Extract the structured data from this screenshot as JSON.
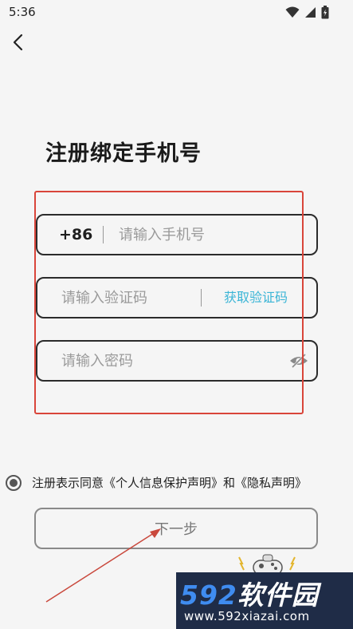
{
  "status_bar": {
    "time": "5:36"
  },
  "header": {
    "title": "注册绑定手机号"
  },
  "form": {
    "phone": {
      "prefix": "+86",
      "placeholder": "请输入手机号",
      "value": ""
    },
    "code": {
      "placeholder": "请输入验证码",
      "value": "",
      "get_code_label": "获取验证码"
    },
    "password": {
      "placeholder": "请输入密码",
      "value": ""
    }
  },
  "agreement": {
    "text": "注册表示同意《个人信息保护声明》和《隐私声明》",
    "checked": true
  },
  "next_button": {
    "label": "下一步"
  },
  "watermark": {
    "brand_num": "592",
    "brand_text": "软件园",
    "url": "www.592xiazai.com"
  },
  "colors": {
    "accent": "#3bb5d6",
    "annotation_red": "#d9453a",
    "watermark_bg": "#1f2c47"
  },
  "icons": [
    "wifi-icon",
    "signal-icon",
    "battery-icon",
    "back-arrow-icon",
    "eye-off-icon",
    "radio-icon"
  ]
}
